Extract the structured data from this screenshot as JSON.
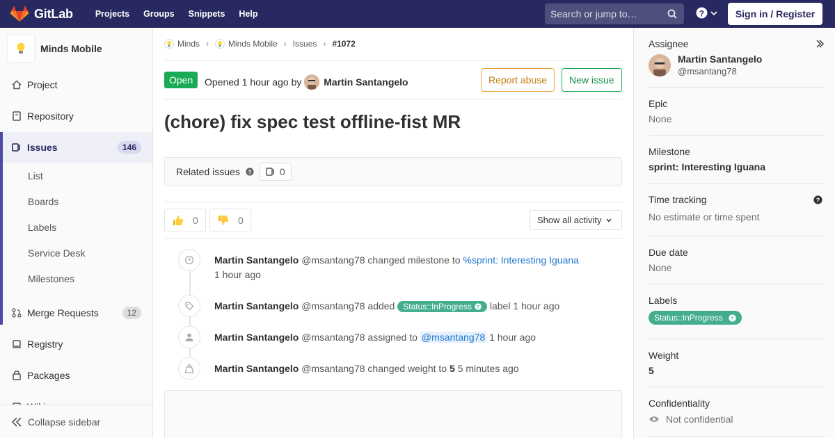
{
  "topnav": {
    "brand": "GitLab",
    "links": [
      "Projects",
      "Groups",
      "Snippets",
      "Help"
    ],
    "search_placeholder": "Search or jump to…",
    "signin_label": "Sign in / Register"
  },
  "sidebar": {
    "project_name": "Minds Mobile",
    "items": [
      {
        "label": "Project"
      },
      {
        "label": "Repository"
      },
      {
        "label": "Issues",
        "count": "146"
      },
      {
        "label": "Merge Requests",
        "count": "12"
      },
      {
        "label": "Registry"
      },
      {
        "label": "Packages"
      },
      {
        "label": "Wiki"
      }
    ],
    "issue_subitems": [
      "List",
      "Boards",
      "Labels",
      "Service Desk",
      "Milestones"
    ],
    "collapse_label": "Collapse sidebar"
  },
  "breadcrumb": {
    "items": [
      "Minds",
      "Minds Mobile",
      "Issues"
    ],
    "current": "#1072"
  },
  "issue": {
    "status": "Open",
    "opened_prefix": "Opened",
    "opened_time": "1 hour ago",
    "opened_by": "by",
    "author": "Martin Santangelo",
    "report_abuse_label": "Report abuse",
    "new_issue_label": "New issue",
    "title": "(chore) fix spec test offline-fist MR",
    "related_label": "Related issues",
    "related_count": "0",
    "thumbs_up_count": "0",
    "thumbs_down_count": "0",
    "activity_filter": "Show all activity"
  },
  "timeline": [
    {
      "author": "Martin Santangelo",
      "handle": "@msantang78",
      "action": "changed milestone to",
      "link": "%sprint: Interesting Iguana",
      "time": "1 hour ago"
    },
    {
      "author": "Martin Santangelo",
      "handle": "@msantang78",
      "action": "added",
      "label": "Status::InProgress",
      "suffix": "label 1 hour ago"
    },
    {
      "author": "Martin Santangelo",
      "handle": "@msantang78",
      "action": "assigned to",
      "mention": "@msantang78",
      "time": "1 hour ago"
    },
    {
      "author": "Martin Santangelo",
      "handle": "@msantang78",
      "action": "changed weight to",
      "weight": "5",
      "time": "5 minutes ago"
    }
  ],
  "right_sidebar": {
    "assignee_label": "Assignee",
    "assignee_name": "Martin Santangelo",
    "assignee_handle": "@msantang78",
    "epic_label": "Epic",
    "epic_value": "None",
    "milestone_label": "Milestone",
    "milestone_value": "sprint: Interesting Iguana",
    "time_tracking_label": "Time tracking",
    "time_tracking_value": "No estimate or time spent",
    "due_date_label": "Due date",
    "due_date_value": "None",
    "labels_label": "Labels",
    "labels_value": "Status::InProgress",
    "weight_label": "Weight",
    "weight_value": "5",
    "confidentiality_label": "Confidentiality",
    "confidentiality_value": "Not confidential"
  },
  "colors": {
    "nav_bg": "#292961",
    "open_green": "#1aaa55",
    "label_green": "#44ad8e",
    "link_blue": "#1f78d1",
    "abuse_orange": "#e9a23b"
  }
}
